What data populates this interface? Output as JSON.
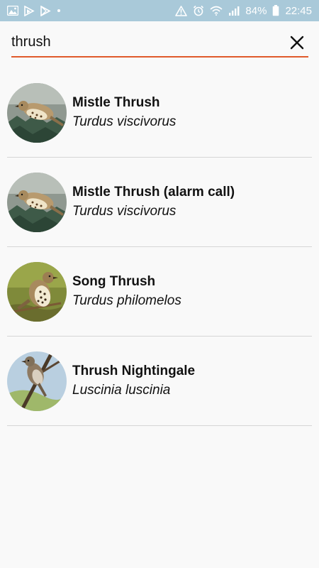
{
  "status_bar": {
    "battery": "84%",
    "time": "22:45",
    "left_icons": [
      "gallery-icon",
      "play-store-icon",
      "google-play-icon",
      "dot-icon"
    ],
    "right_icons": [
      "warning-icon",
      "alarm-icon",
      "wifi-icon",
      "signal-icon",
      "battery-icon"
    ]
  },
  "search": {
    "query": "thrush",
    "clear_icon": "close-icon",
    "accent_color": "#e05a2b"
  },
  "results": [
    {
      "name": "Mistle Thrush",
      "latin": "Turdus viscivorus",
      "photo": "mistle-thrush-photo"
    },
    {
      "name": "Mistle Thrush (alarm call)",
      "latin": "Turdus viscivorus",
      "photo": "mistle-thrush-photo"
    },
    {
      "name": "Song Thrush",
      "latin": "Turdus philomelos",
      "photo": "song-thrush-photo"
    },
    {
      "name": "Thrush Nightingale",
      "latin": "Luscinia luscinia",
      "photo": "thrush-nightingale-photo"
    }
  ]
}
